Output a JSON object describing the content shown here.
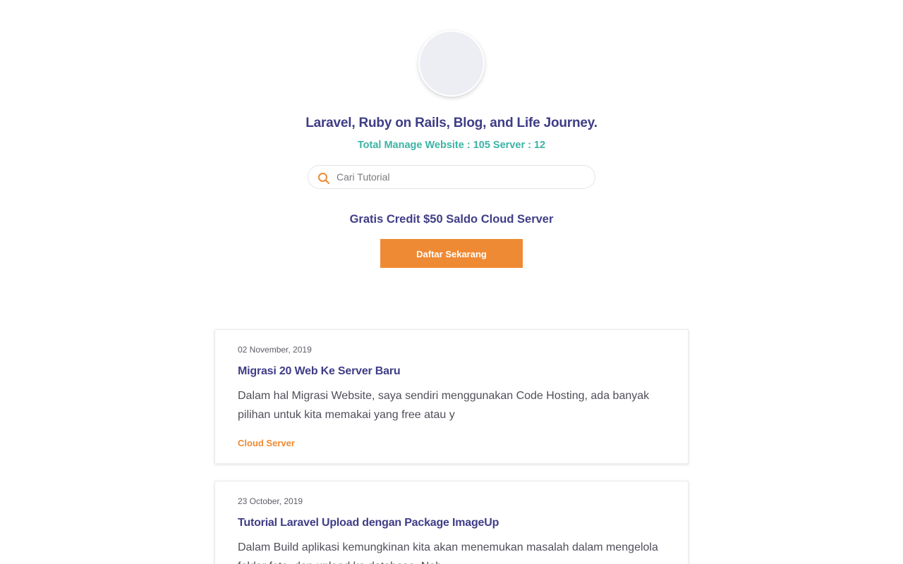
{
  "header": {
    "tagline": "Laravel, Ruby on Rails, Blog, and Life Journey.",
    "stats": "Total Manage Website : 105 Server : 12"
  },
  "search": {
    "placeholder": "Cari Tutorial",
    "value": ""
  },
  "promo": {
    "headline": "Gratis Credit $50 Saldo Cloud Server",
    "button_label": "Daftar Sekarang"
  },
  "posts": [
    {
      "date": "02 November, 2019",
      "title": "Migrasi 20 Web Ke Server Baru",
      "excerpt": "Dalam hal Migrasi Website, saya sendiri menggunakan Code Hosting, ada banyak pilihan untuk kita memakai yang free atau y",
      "tag": "Cloud Server"
    },
    {
      "date": "23 October, 2019",
      "title": "Tutorial Laravel Upload dengan Package ImageUp",
      "excerpt": "Dalam Build aplikasi kemungkinan kita akan menemukan masalah dalam mengelola folder foto, dan upload ke database. Nah"
    }
  ],
  "colors": {
    "primary": "#3f3d86",
    "accent": "#ef8a34",
    "teal": "#3bb3a5",
    "text": "#4f4f5a"
  },
  "icons": {
    "search": "search-icon"
  }
}
